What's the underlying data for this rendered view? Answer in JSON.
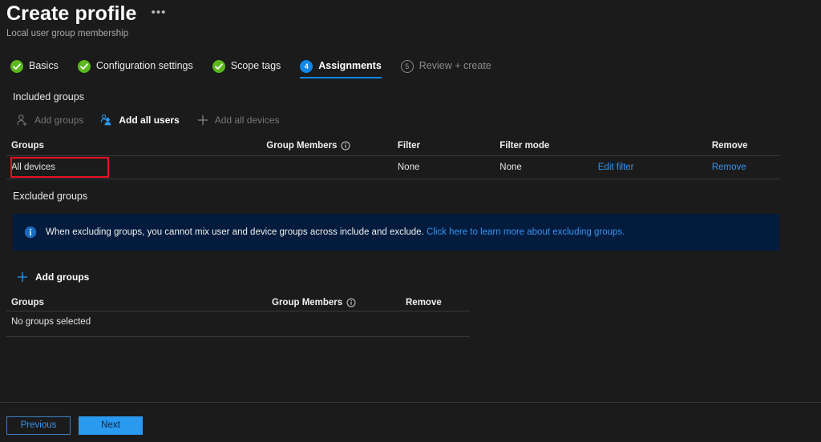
{
  "header": {
    "title": "Create profile",
    "subtitle": "Local user group membership",
    "more_label": "•••"
  },
  "wizard": {
    "tabs": [
      {
        "label": "Basics",
        "state": "done",
        "marker": "check"
      },
      {
        "label": "Configuration settings",
        "state": "done",
        "marker": "check"
      },
      {
        "label": "Scope tags",
        "state": "done",
        "marker": "check"
      },
      {
        "label": "Assignments",
        "state": "current",
        "marker": "4"
      },
      {
        "label": "Review + create",
        "state": "pending",
        "marker": "5"
      }
    ],
    "accent_color": "#0f87e8",
    "done_color": "#5ab81c"
  },
  "included": {
    "section_label": "Included groups",
    "commands": [
      {
        "label": "Add groups",
        "icon": "add-user-icon",
        "enabled": false
      },
      {
        "label": "Add all users",
        "icon": "add-all-users-icon",
        "enabled": true
      },
      {
        "label": "Add all devices",
        "icon": "plus-icon",
        "enabled": false
      }
    ],
    "columns": {
      "groups": "Groups",
      "group_members": "Group Members",
      "filter": "Filter",
      "filter_mode": "Filter mode",
      "edit": "",
      "remove": "Remove"
    },
    "rows": [
      {
        "group": "All devices",
        "group_members": "",
        "filter": "None",
        "filter_mode": "None",
        "edit_filter": "Edit filter",
        "remove": "Remove",
        "highlighted": true
      }
    ]
  },
  "banner": {
    "text": "When excluding groups, you cannot mix user and device groups across include and exclude.",
    "link_text": "Click here to learn more about excluding groups.",
    "background": "#031b3d",
    "icon": "info-icon"
  },
  "excluded": {
    "section_label": "Excluded groups",
    "add_groups": {
      "label": "Add groups",
      "icon": "plus-icon",
      "enabled": true
    },
    "columns": {
      "groups": "Groups",
      "group_members": "Group Members",
      "remove": "Remove"
    },
    "empty_text": "No groups selected"
  },
  "footer": {
    "previous_label": "Previous",
    "next_label": "Next",
    "primary_color": "#2a99f0"
  }
}
